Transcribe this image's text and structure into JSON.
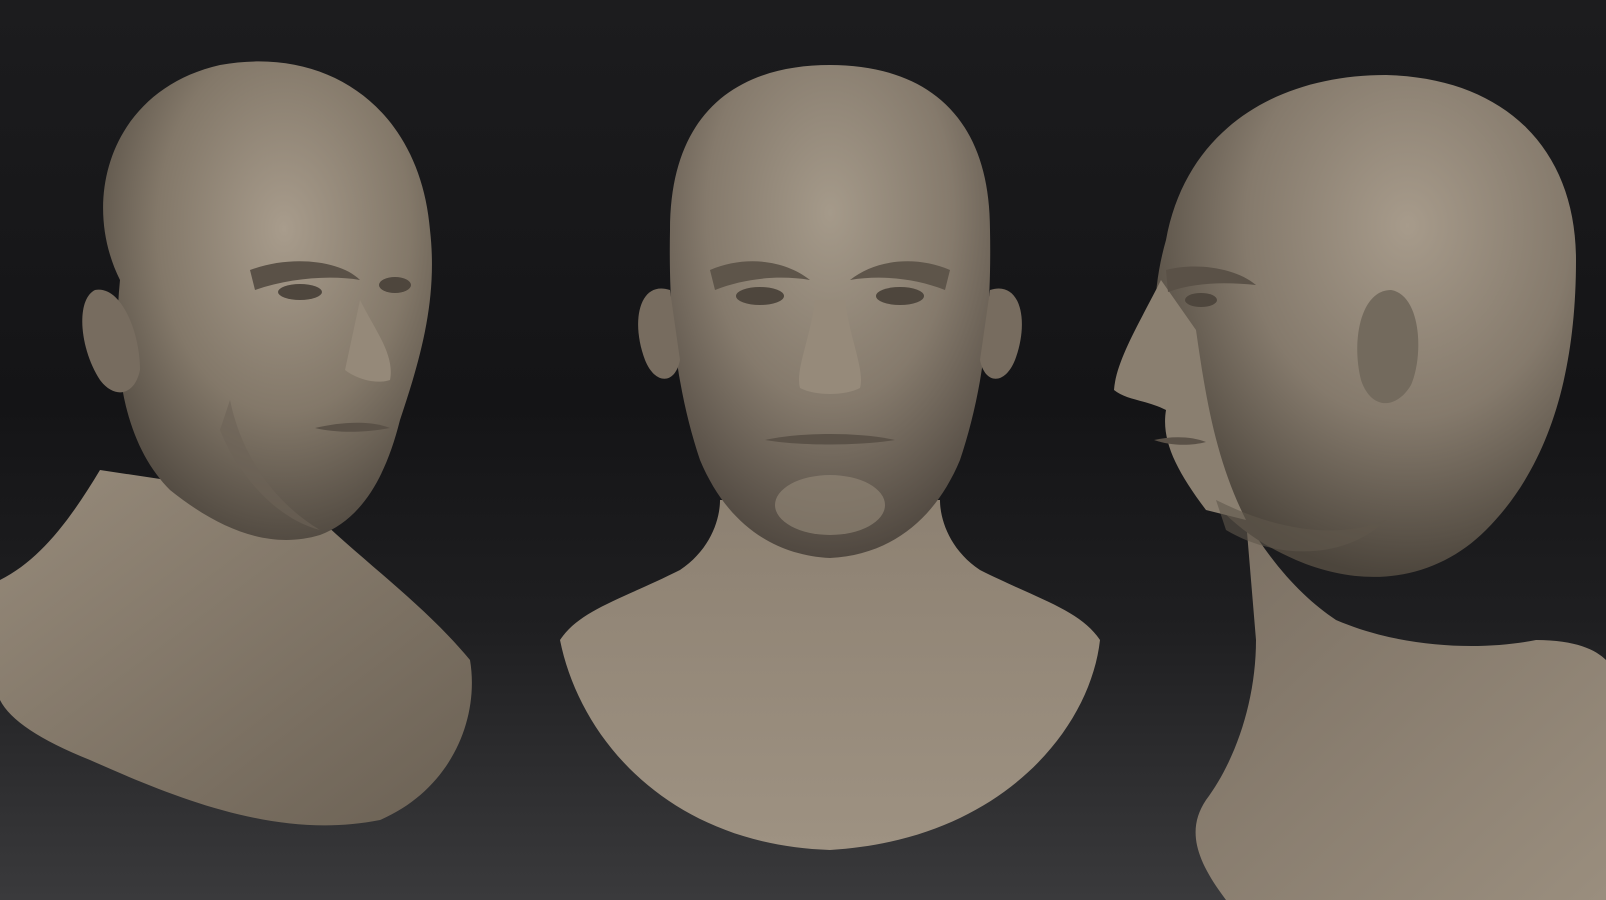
{
  "scene": {
    "background_top": "#1c1c1e",
    "background_bottom": "#3a3a3c",
    "clay_light": "#a39888",
    "clay_mid": "#857a6c",
    "clay_dark": "#4e463d"
  },
  "views": [
    {
      "id": "three-quarter",
      "icon": "bust-three-quarter-view"
    },
    {
      "id": "front",
      "icon": "bust-front-view"
    },
    {
      "id": "profile",
      "icon": "bust-profile-view"
    }
  ]
}
